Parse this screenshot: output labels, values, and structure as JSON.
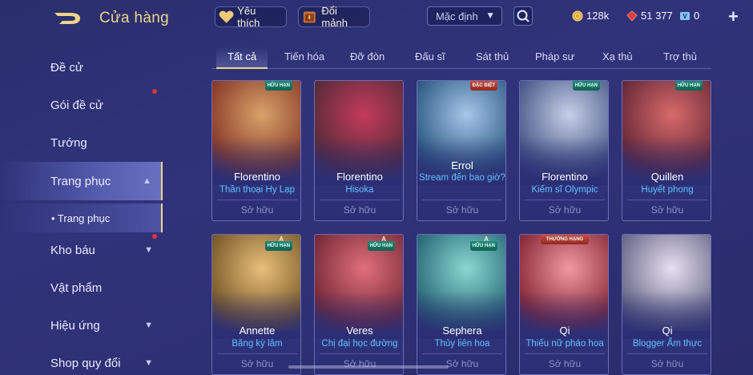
{
  "header": {
    "title": "Cửa hàng",
    "favorites_label": "Yêu thích",
    "exchange_label": "Đổi mảnh",
    "sort_value": "Mặc định",
    "currencies": {
      "gold": "128k",
      "gems": "51 377",
      "vouchers": "0"
    },
    "plus_label": "+"
  },
  "sidebar": {
    "items": [
      {
        "label": "Đề cử",
        "dot": false
      },
      {
        "label": "Gói đề cử",
        "dot": true
      },
      {
        "label": "Tướng",
        "dot": false
      },
      {
        "label": "Trang phục",
        "dot": false,
        "active": true
      },
      {
        "label": "Kho báu",
        "dot": true
      },
      {
        "label": "Vật phẩm",
        "dot": false
      },
      {
        "label": "Hiệu ứng",
        "dot": false
      },
      {
        "label": "Shop quy đổi",
        "dot": false
      }
    ],
    "subitem": "• Trang phục"
  },
  "tabs": [
    "Tất cả",
    "Tiến hóa",
    "Đỡ đòn",
    "Đấu sĩ",
    "Sát thủ",
    "Pháp sư",
    "Xạ thủ",
    "Trợ thủ"
  ],
  "cards": [
    {
      "hero": "Florentino",
      "skin": "Thần thoại Hy Lạp",
      "status": "Sở hữu",
      "badge": "HỮU HẠN",
      "grade": ""
    },
    {
      "hero": "Florentino",
      "skin": "Hisoka",
      "status": "Sở hữu",
      "badge": "",
      "grade": ""
    },
    {
      "hero": "Errol",
      "skin": "Stream đến bao giờ?",
      "status": "Sở hữu",
      "badge": "ĐẶC BIỆT",
      "grade": ""
    },
    {
      "hero": "Florentino",
      "skin": "Kiếm sĩ Olympic",
      "status": "Sở hữu",
      "badge": "HỮU HẠN",
      "grade": ""
    },
    {
      "hero": "Quillen",
      "skin": "Huyết phong",
      "status": "Sở hữu",
      "badge": "HỮU HẠN",
      "grade": ""
    },
    {
      "hero": "Annette",
      "skin": "Băng kỳ lâm",
      "status": "Sở hữu",
      "badge": "HỮU HẠN",
      "grade": "A"
    },
    {
      "hero": "Veres",
      "skin": "Chị đại học đường",
      "status": "Sở hữu",
      "badge": "HỮU HẠN",
      "grade": "A"
    },
    {
      "hero": "Sephera",
      "skin": "Thủy liên hoa",
      "status": "Sở hữu",
      "badge": "HỮU HẠN",
      "grade": "A"
    },
    {
      "hero": "Qi",
      "skin": "Thiếu nữ pháo hoa",
      "status": "Sở hữu",
      "badge": "THƯỞNG HẠNG",
      "grade": ""
    },
    {
      "hero": "Qi",
      "skin": "Blogger Ẩm thực",
      "status": "Sở hữu",
      "badge": "",
      "grade": ""
    }
  ],
  "card_art_colors": [
    [
      "#8a3b2a",
      "#d8a36a"
    ],
    [
      "#5a2b3a",
      "#c43b5a"
    ],
    [
      "#2f5c86",
      "#a8c6e8"
    ],
    [
      "#4a5a8a",
      "#c8d0e8"
    ],
    [
      "#6a2a3a",
      "#d86a6a"
    ],
    [
      "#7a5a2a",
      "#e8c07a"
    ],
    [
      "#7a2a3a",
      "#e0707a"
    ],
    [
      "#2a6a7a",
      "#8ad8d0"
    ],
    [
      "#8a2a3a",
      "#f09aa0"
    ],
    [
      "#6a6a8a",
      "#e8e0f0"
    ]
  ],
  "accent_color": "#f0d48a",
  "skin_name_color": "#61c0ff"
}
